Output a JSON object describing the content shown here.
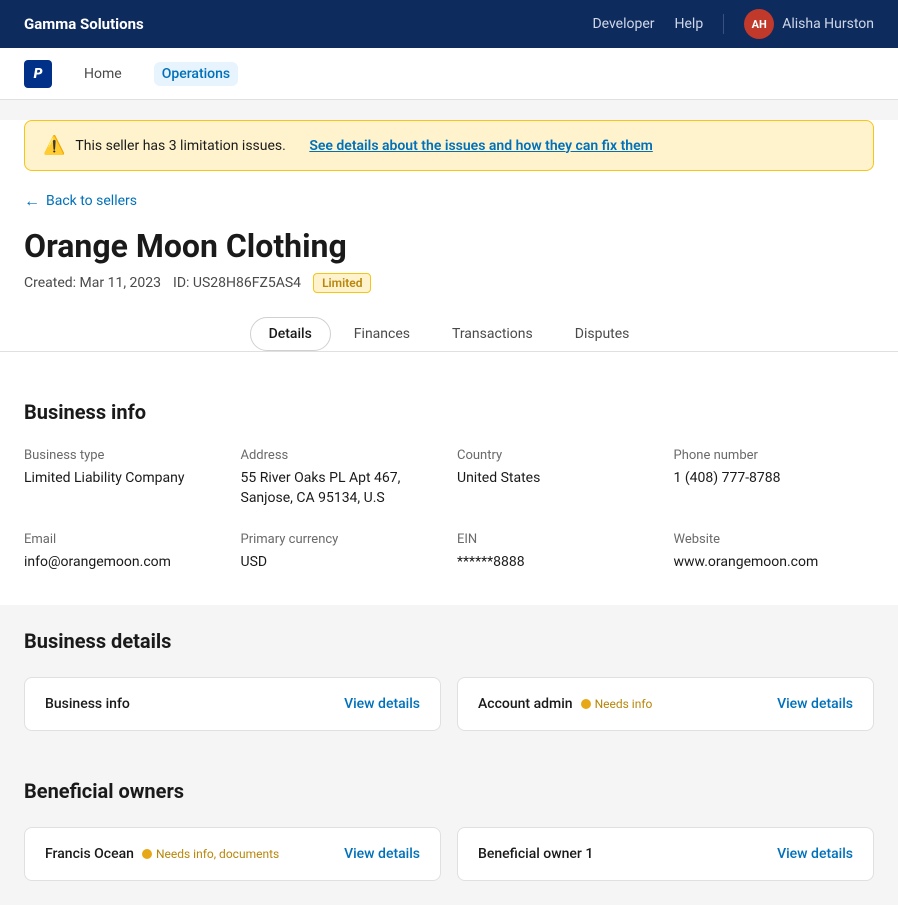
{
  "topnav": {
    "brand": "Gamma Solutions",
    "links": [
      "Developer",
      "Help"
    ],
    "user_initials": "AH",
    "user_name": "Alisha Hurston"
  },
  "subnav": {
    "home_label": "Home",
    "operations_label": "Operations"
  },
  "alert": {
    "text": "This seller has 3 limitation issues.",
    "link_text": "See details about the issues and how they can fix them"
  },
  "back_link": "Back to sellers",
  "seller": {
    "name": "Orange Moon Clothing",
    "created": "Created: Mar 11, 2023",
    "id": "ID: US28H86FZ5AS4",
    "status": "Limited"
  },
  "tabs": [
    {
      "label": "Details",
      "active": true
    },
    {
      "label": "Finances",
      "active": false
    },
    {
      "label": "Transactions",
      "active": false
    },
    {
      "label": "Disputes",
      "active": false
    }
  ],
  "business_info": {
    "section_title": "Business info",
    "fields": [
      {
        "label": "Business type",
        "value": "Limited Liability Company"
      },
      {
        "label": "Address",
        "value": "55 River Oaks PL Apt 467,\nSanjose, CA 95134, U.S"
      },
      {
        "label": "Country",
        "value": "United States"
      },
      {
        "label": "Phone number",
        "value": "1 (408) 777-8788"
      },
      {
        "label": "Email",
        "value": "info@orangemoon.com"
      },
      {
        "label": "Primary currency",
        "value": "USD"
      },
      {
        "label": "EIN",
        "value": "******8888"
      },
      {
        "label": "Website",
        "value": "www.orangemoon.com"
      }
    ]
  },
  "business_details": {
    "section_title": "Business details",
    "cards": [
      {
        "label": "Business info",
        "needs_info": false,
        "needs_text": "",
        "view_label": "View details"
      },
      {
        "label": "Account admin",
        "needs_info": true,
        "needs_text": "Needs info",
        "view_label": "View details"
      }
    ]
  },
  "beneficial_owners": {
    "section_title": "Beneficial owners",
    "cards": [
      {
        "label": "Francis Ocean",
        "needs_info": true,
        "needs_text": "Needs info, documents",
        "view_label": "View details"
      },
      {
        "label": "Beneficial owner 1",
        "needs_info": false,
        "needs_text": "",
        "view_label": "View details"
      }
    ]
  }
}
